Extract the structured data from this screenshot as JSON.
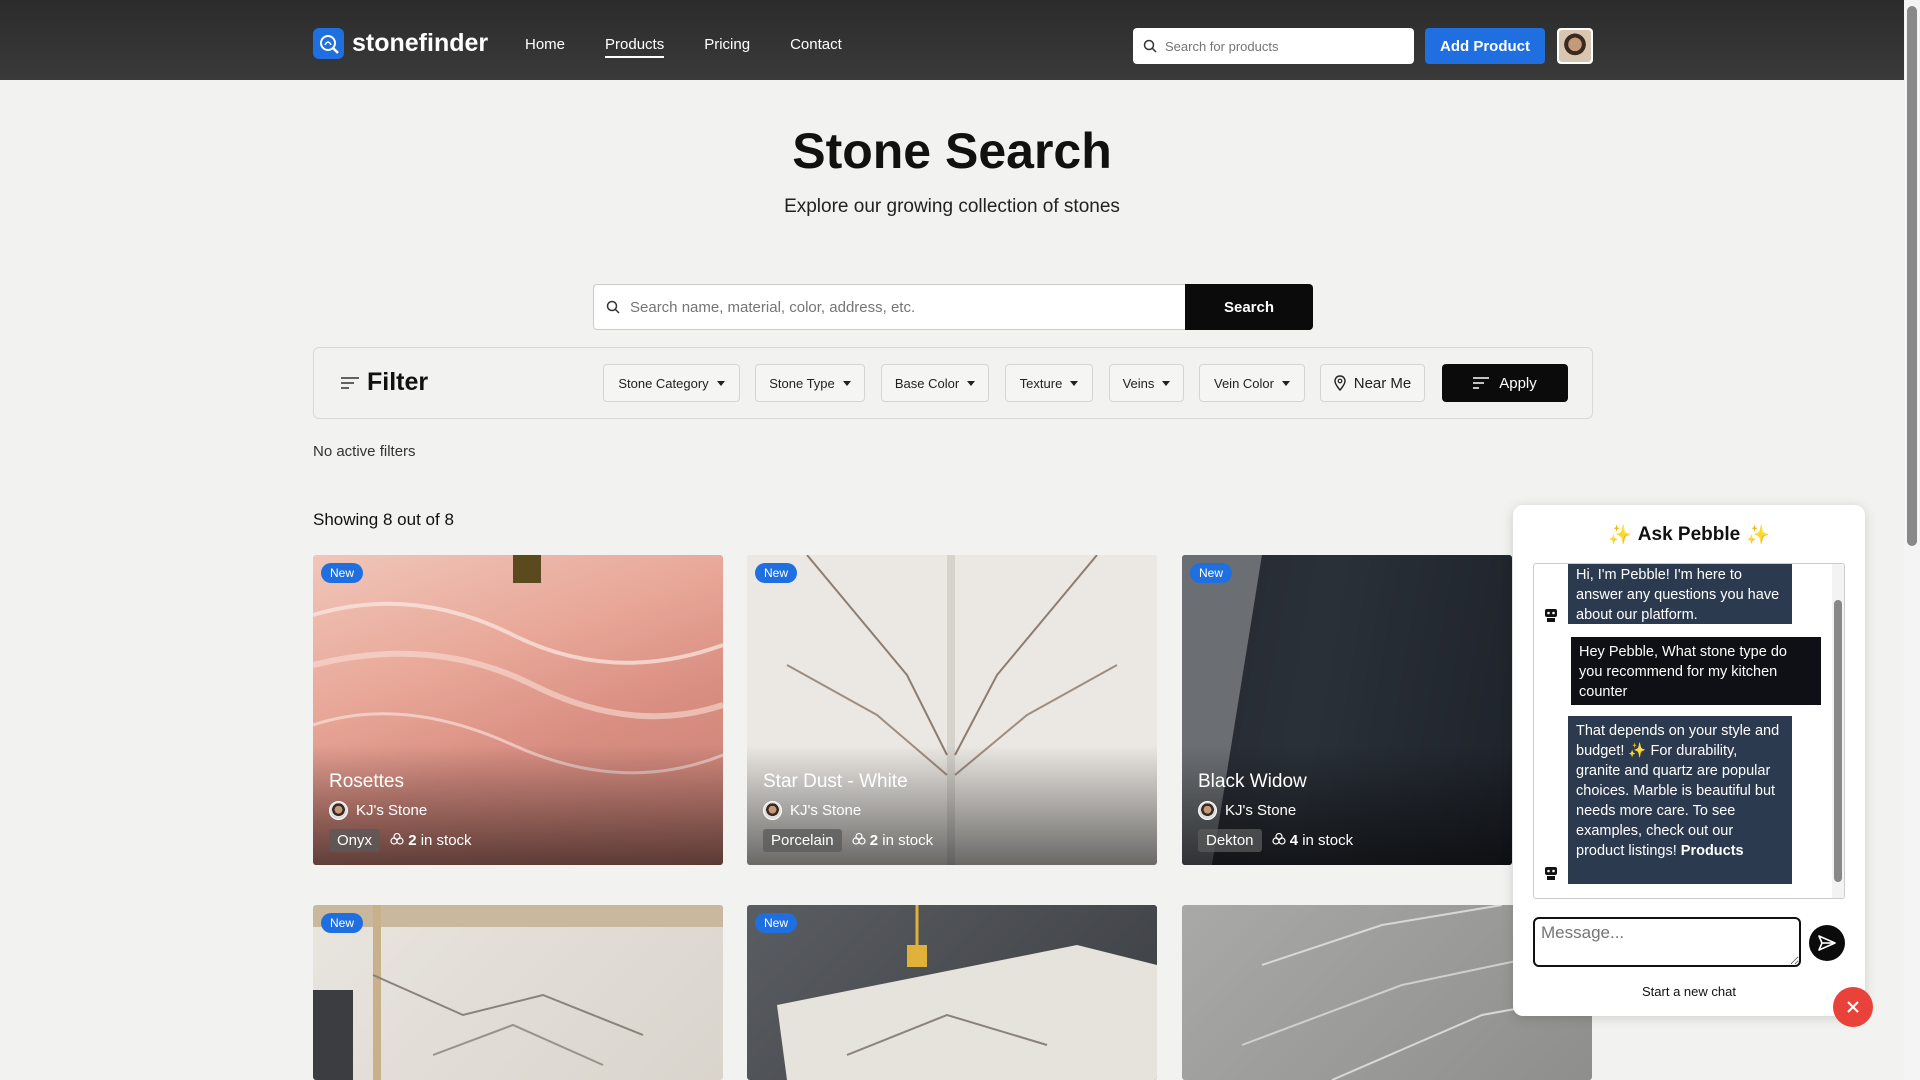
{
  "nav": {
    "brand": "stonefinder",
    "links": [
      "Home",
      "Products",
      "Pricing",
      "Contact"
    ],
    "active": "Products",
    "search_placeholder": "Search for products",
    "add_product": "Add Product"
  },
  "hero": {
    "title": "Stone Search",
    "subtitle": "Explore our growing collection of stones"
  },
  "search": {
    "placeholder": "Search name, material, color, address, etc.",
    "button": "Search"
  },
  "filter": {
    "title": "Filter",
    "dropdowns": [
      "Stone Category",
      "Stone Type",
      "Base Color",
      "Texture",
      "Veins",
      "Vein Color"
    ],
    "near_me": "Near Me",
    "apply": "Apply",
    "status": "No active filters"
  },
  "results": {
    "prefix": "Showing",
    "shown": "8",
    "of": "out of",
    "total": "8"
  },
  "cards": [
    {
      "badge": "New",
      "name": "Rosettes",
      "seller": "KJ's Stone",
      "material": "Onyx",
      "stock_count": "2",
      "stock_label": "in stock"
    },
    {
      "badge": "New",
      "name": "Star Dust - White",
      "seller": "KJ's Stone",
      "material": "Porcelain",
      "stock_count": "2",
      "stock_label": "in stock"
    },
    {
      "badge": "New",
      "name": "Black Widow",
      "seller": "KJ's Stone",
      "material": "Dekton",
      "stock_count": "4",
      "stock_label": "in stock"
    },
    {
      "badge": "New"
    },
    {
      "badge": "New"
    },
    {}
  ],
  "chat": {
    "title": "Ask Pebble",
    "messages": [
      {
        "role": "bot",
        "text": "Hi, I'm Pebble! I'm here to answer any questions you have about our platform."
      },
      {
        "role": "user",
        "text": "Hey Pebble, What stone type do you recommend for my kitchen counter"
      },
      {
        "role": "bot",
        "text": "That depends on your style and budget! ✨ For durability, granite and quartz are popular choices. Marble is beautiful but needs more care. To see examples, check out our product listings!",
        "link": "Products"
      }
    ],
    "input_placeholder": "Message...",
    "new_chat": "Start a new chat"
  },
  "colors": {
    "accent": "#1f6fe0",
    "close": "#e9423a",
    "topbar": "#333333"
  }
}
